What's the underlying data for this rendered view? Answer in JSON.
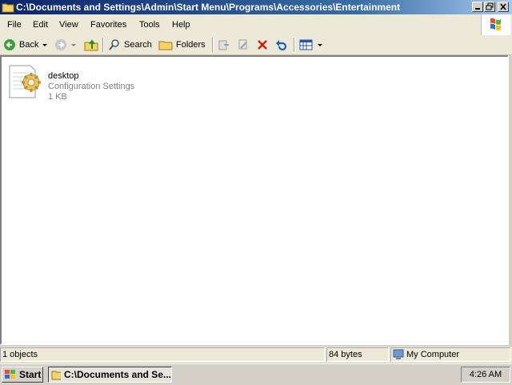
{
  "window": {
    "title": "C:\\Documents and Settings\\Admin\\Start Menu\\Programs\\Accessories\\Entertainment"
  },
  "menu": [
    "File",
    "Edit",
    "View",
    "Favorites",
    "Tools",
    "Help"
  ],
  "toolbar": {
    "back_label": "Back",
    "search_label": "Search",
    "folders_label": "Folders"
  },
  "file": {
    "name": "desktop",
    "type": "Configuration Settings",
    "size": "1 KB"
  },
  "status": {
    "objects": "1 objects",
    "bytes": "84 bytes",
    "location": "My Computer"
  },
  "taskbar": {
    "start_label": "Start",
    "task_label": "C:\\Documents and Se...",
    "clock": "4:26 AM"
  }
}
